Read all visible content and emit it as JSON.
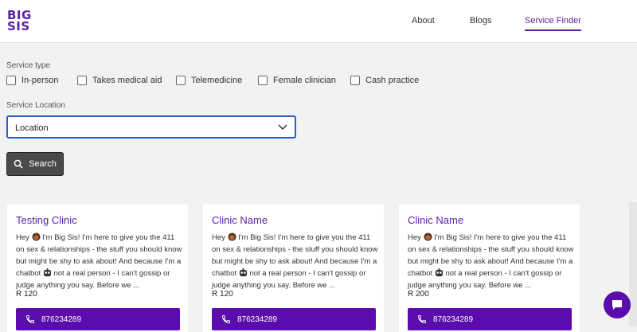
{
  "header": {
    "logo_line1": "BIG",
    "logo_line2": "SIS",
    "nav": [
      "About",
      "Blogs",
      "Service Finder"
    ]
  },
  "filters": {
    "service_type_label": "Service type",
    "options": [
      "In-person",
      "Takes medical aid",
      "Telemedicine",
      "Female clinician",
      "Cash practice"
    ],
    "location_label": "Service Location",
    "location_value": "Location",
    "search_label": "Search"
  },
  "cards": [
    {
      "title": "Testing Clinic",
      "desc_1": "Hey",
      "desc_2": "I'm Big Sis! I'm here to give you the 411 on sex & relationships - the stuff you should know but might be shy to ask about! And because I'm a chatbot",
      "desc_3": "not a real person - I can't gossip or judge anything you say. Before we ...",
      "price": "R 120",
      "phone": "876234289"
    },
    {
      "title": "Clinic Name",
      "desc_1": "Hey",
      "desc_2": "I'm Big Sis! I'm here to give you the 411 on sex & relationships - the stuff you should know but might be shy to ask about! And because I'm a chatbot",
      "desc_3": "not a real person - I can't gossip or judge anything you say. Before we ...",
      "price": "R 120",
      "phone": "876234289"
    },
    {
      "title": "Clinic Name",
      "desc_1": "Hey",
      "desc_2": "I'm Big Sis! I'm here to give you the 411 on sex & relationships - the stuff you should know but might be shy to ask about! And because I'm a chatbot",
      "desc_3": "not a real person - I can't gossip or judge anything you say. Before we ...",
      "price": "R 200",
      "phone": "876234289"
    }
  ],
  "icons": {
    "dropdown": "chevron-down-icon",
    "search": "search-icon",
    "phone": "phone-icon",
    "chat": "chat-bubble-icon",
    "girl_emoji": "girl-emoji-icon",
    "robot_emoji": "robot-emoji-icon"
  },
  "colors": {
    "brand": "#5b22a6",
    "button_purple": "#5a0cad",
    "select_border": "#2c5cc5",
    "search_button": "#4a4a4a"
  }
}
